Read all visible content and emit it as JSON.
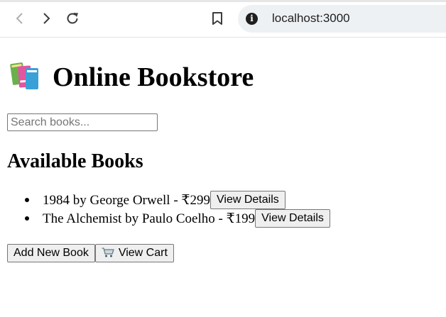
{
  "browser": {
    "url": "localhost:3000",
    "info_glyph": "i"
  },
  "page": {
    "title": "Online Bookstore",
    "title_icon": "books-emoji",
    "search": {
      "placeholder": "Search books...",
      "value": ""
    },
    "section_heading": "Available Books",
    "books": [
      {
        "text": "1984 by George Orwell - ₹299",
        "button": "View Details"
      },
      {
        "text": "The Alchemist by Paulo Coelho - ₹199",
        "button": "View Details"
      }
    ],
    "actions": {
      "add_book": "Add New Book",
      "view_cart": "View Cart",
      "view_cart_icon": "shopping-cart-icon"
    }
  }
}
